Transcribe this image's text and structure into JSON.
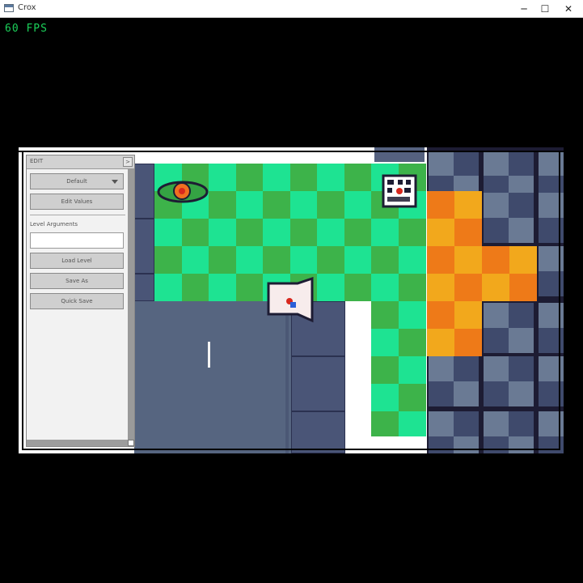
{
  "window": {
    "title": "Crox",
    "minimize_glyph": "─",
    "maximize_glyph": "☐",
    "close_glyph": "✕"
  },
  "hud": {
    "fps": "60 FPS"
  },
  "editor": {
    "header": "EDIT",
    "collapse_glyph": ">",
    "select_value": "Default",
    "edit_values_label": "Edit Values",
    "level_arguments_label": "Level Arguments",
    "level_arguments_value": "",
    "load_level_label": "Load Level",
    "save_as_label": "Save As",
    "quick_save_label": "Quick Save"
  },
  "colors": {
    "green_light": "#1ee392",
    "green_dark": "#3db34a",
    "orange_light": "#f2a81c",
    "orange_dark": "#ee7a18",
    "metal": "#4a5577",
    "fps": "#1bd15a"
  },
  "icons": [
    "app-icon",
    "minimize-icon",
    "maximize-icon",
    "close-icon",
    "eye-switch-icon",
    "target-sign-icon",
    "player-character-icon",
    "dropdown-arrow-icon"
  ]
}
